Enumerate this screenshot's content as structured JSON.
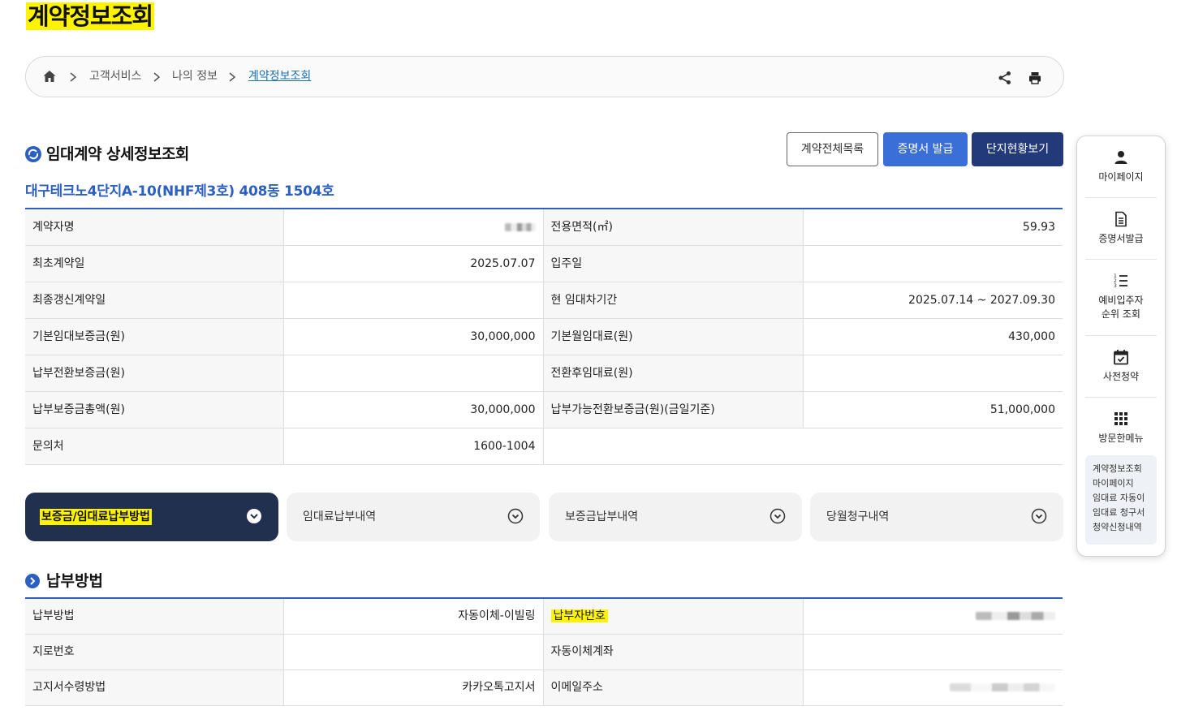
{
  "page_title": "계약정보조회",
  "breadcrumb": {
    "items": [
      "고객서비스",
      "나의 정보",
      "계약정보조회"
    ]
  },
  "section": {
    "title": "임대계약 상세정보조회",
    "buttons": {
      "list": "계약전체목록",
      "certificate": "증명서 발급",
      "complex_status": "단지현황보기"
    },
    "complex_name": "대구테크노4단지A-10(NHF제3호) 408동 1504호"
  },
  "contract": {
    "rows": [
      {
        "l1": "계약자명",
        "v1": "",
        "l2": "전용면적(㎡)",
        "v2": "59.93"
      },
      {
        "l1": "최초계약일",
        "v1": "2025.07.07",
        "l2": "입주일",
        "v2": ""
      },
      {
        "l1": "최종갱신계약일",
        "v1": "",
        "l2": "현 임대차기간",
        "v2": "2025.07.14 ~ 2027.09.30"
      },
      {
        "l1": "기본임대보증금(원)",
        "v1": "30,000,000",
        "l2": "기본월임대료(원)",
        "v2": "430,000"
      },
      {
        "l1": "납부전환보증금(원)",
        "v1": "",
        "l2": "전환후임대료(원)",
        "v2": ""
      },
      {
        "l1": "납부보증금총액(원)",
        "v1": "30,000,000",
        "l2": "납부가능전환보증금(원)(금일기준)",
        "v2": "51,000,000"
      },
      {
        "l1": "문의처",
        "v1": "1600-1004",
        "l2": "",
        "v2": ""
      }
    ]
  },
  "tabs": [
    {
      "label": "보증금/임대료납부방법",
      "active": true
    },
    {
      "label": "임대료납부내역",
      "active": false
    },
    {
      "label": "보증금납부내역",
      "active": false
    },
    {
      "label": "당월청구내역",
      "active": false
    }
  ],
  "payment": {
    "title": "납부방법",
    "rows": [
      {
        "l1": "납부방법",
        "v1": "자동이체-이빌링",
        "l2": "납부자번호",
        "v2": ""
      },
      {
        "l1": "지로번호",
        "v1": "",
        "l2": "자동이체계좌",
        "v2": ""
      },
      {
        "l1": "고지서수령방법",
        "v1": "카카오톡고지서",
        "l2": "이메일주소",
        "v2": ""
      }
    ]
  },
  "side_menu": {
    "items": [
      {
        "label": "마이페이지",
        "icon": "person-icon"
      },
      {
        "label": "증명서발급",
        "icon": "document-icon"
      },
      {
        "label": "예비입주자\n순위 조회",
        "icon": "ranked-list-icon"
      },
      {
        "label": "사전청약",
        "icon": "calendar-check-icon"
      },
      {
        "label": "방문한메뉴",
        "icon": "grid-icon"
      }
    ],
    "recent": [
      "계약정보조회",
      "마이페이지",
      "임대료 자동이",
      "임대료 청구서",
      "청약신청내역"
    ]
  },
  "colors": {
    "accent_blue": "#2c5fc2",
    "button_blue": "#3a6fd8",
    "button_navy": "#233a7a",
    "tab_active": "#22304f",
    "highlight": "#fff400"
  }
}
